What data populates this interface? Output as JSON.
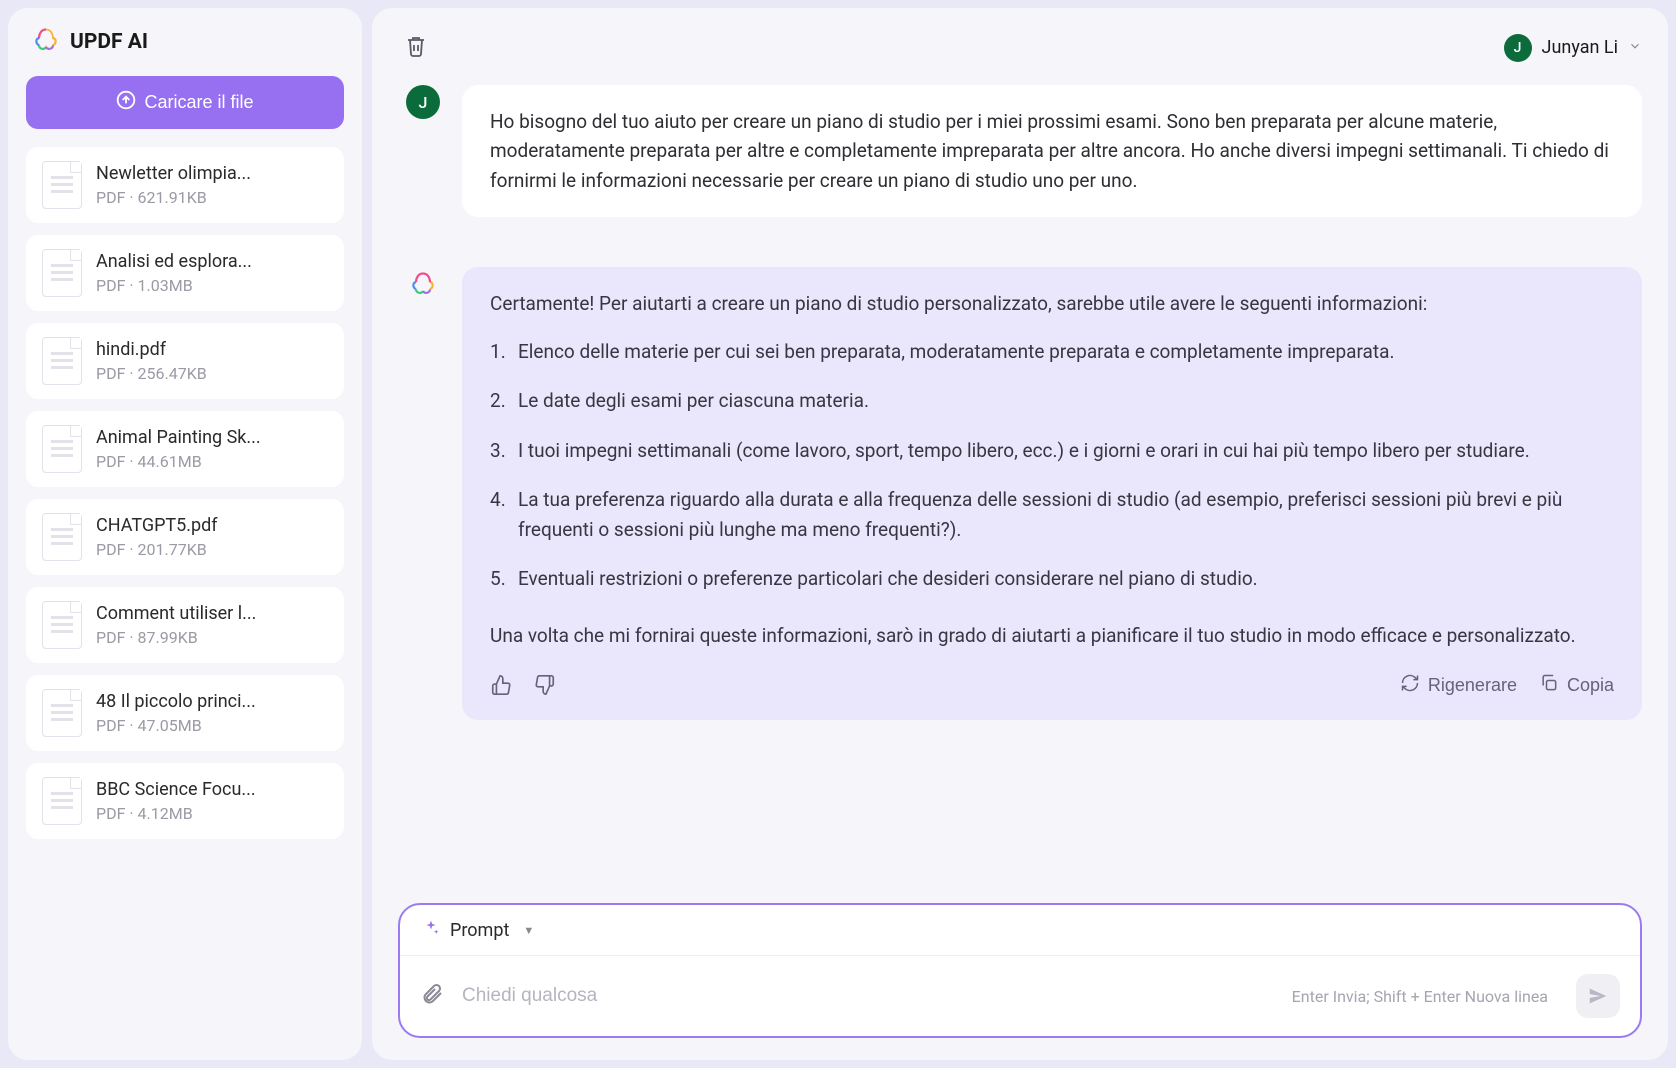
{
  "app": {
    "title": "UPDF AI"
  },
  "sidebar": {
    "upload_label": "Caricare il file",
    "files": [
      {
        "name": "Newletter olimpia...",
        "type": "PDF",
        "size": "621.91KB"
      },
      {
        "name": "Analisi ed esplora...",
        "type": "PDF",
        "size": "1.03MB"
      },
      {
        "name": "hindi.pdf",
        "type": "PDF",
        "size": "256.47KB"
      },
      {
        "name": "Animal Painting Sk...",
        "type": "PDF",
        "size": "44.61MB"
      },
      {
        "name": "CHATGPT5.pdf",
        "type": "PDF",
        "size": "201.77KB"
      },
      {
        "name": "Comment utiliser l...",
        "type": "PDF",
        "size": "87.99KB"
      },
      {
        "name": "48 Il piccolo princi...",
        "type": "PDF",
        "size": "47.05MB"
      },
      {
        "name": "BBC Science Focu...",
        "type": "PDF",
        "size": "4.12MB"
      }
    ]
  },
  "header": {
    "user_initial": "J",
    "user_name": "Junyan Li"
  },
  "chat": {
    "user_message": "Ho bisogno del tuo aiuto per creare un piano di studio per i miei prossimi esami. Sono ben preparata per alcune materie, moderatamente preparata per altre e completamente impreparata per altre ancora. Ho anche diversi impegni settimanali. Ti chiedo di fornirmi le informazioni necessarie per creare un piano di studio uno per uno.",
    "ai_intro": "Certamente! Per aiutarti a creare un piano di studio personalizzato, sarebbe utile avere le seguenti informazioni:",
    "ai_items": [
      "Elenco delle materie per cui sei ben preparata, moderatamente preparata e completamente impreparata.",
      "Le date degli esami per ciascuna materia.",
      "I tuoi impegni settimanali (come lavoro, sport, tempo libero, ecc.) e i giorni e orari in cui hai più tempo libero per studiare.",
      "La tua preferenza riguardo alla durata e alla frequenza delle sessioni di studio (ad esempio, preferisci sessioni più brevi e più frequenti o sessioni più lunghe ma meno frequenti?).",
      "Eventuali restrizioni o preferenze particolari che desideri considerare nel piano di studio."
    ],
    "ai_outro": "Una volta che mi fornirai queste informazioni, sarò in grado di aiutarti a pianificare il tuo studio in modo efficace e personalizzato.",
    "actions": {
      "regenerate": "Rigenerare",
      "copy": "Copia"
    }
  },
  "composer": {
    "prompt_label": "Prompt",
    "placeholder": "Chiedi qualcosa",
    "hint": "Enter Invia; Shift + Enter Nuova linea"
  }
}
